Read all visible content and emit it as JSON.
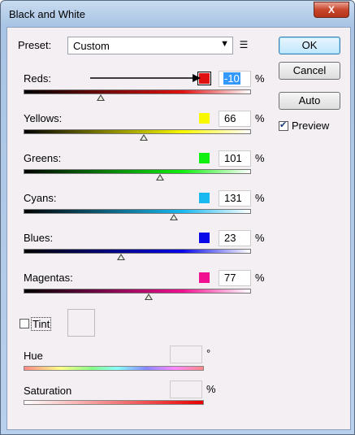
{
  "window": {
    "title": "Black and White",
    "close_label": "X"
  },
  "preset": {
    "label": "Preset:",
    "value": "Custom"
  },
  "buttons": {
    "ok": "OK",
    "cancel": "Cancel",
    "auto": "Auto"
  },
  "preview": {
    "label": "Preview",
    "checked": true
  },
  "sliders": [
    {
      "label": "Reds",
      "value": "-10",
      "color": "#e01010",
      "level": 0.34
    },
    {
      "label": "Yellows",
      "value": "66",
      "color": "#f8f800",
      "level": 0.53
    },
    {
      "label": "Greens",
      "value": "101",
      "color": "#10f010",
      "level": 0.6
    },
    {
      "label": "Cyans",
      "value": "131",
      "color": "#18b8f0",
      "level": 0.66
    },
    {
      "label": "Blues",
      "value": "23",
      "color": "#0808e8",
      "level": 0.43
    },
    {
      "label": "Magentas",
      "value": "77",
      "color": "#f01090",
      "level": 0.55
    }
  ],
  "percent_sign": "%",
  "degree_sign": "°",
  "tint": {
    "label": "Tint",
    "checked": false
  },
  "hue": {
    "label": "Hue"
  },
  "saturation": {
    "label": "Saturation"
  }
}
